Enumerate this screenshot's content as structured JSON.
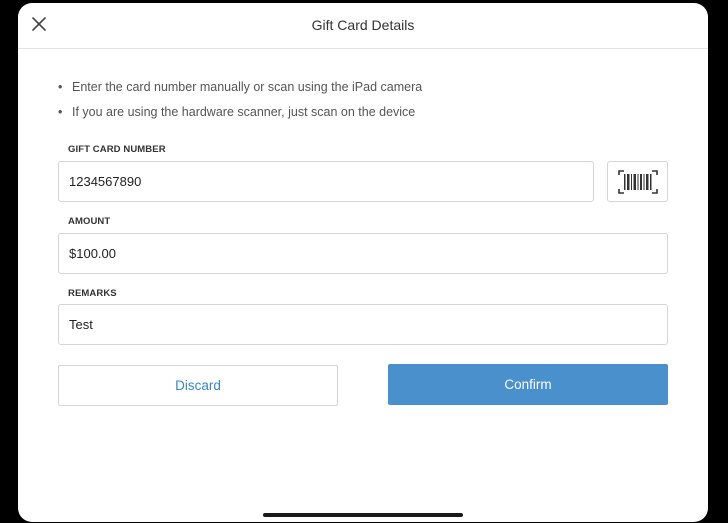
{
  "header": {
    "title": "Gift Card Details",
    "close_icon": "close-icon"
  },
  "instructions": [
    "Enter the card number manually or scan using the iPad camera",
    "If you are using the hardware scanner, just scan on the device"
  ],
  "bullet": "•",
  "fields": {
    "gift_card_number": {
      "label": "GIFT CARD NUMBER",
      "value": "1234567890"
    },
    "amount": {
      "label": "AMOUNT",
      "value": "$100.00"
    },
    "remarks": {
      "label": "REMARKS",
      "value": "Test"
    }
  },
  "scan_button_icon": "barcode-scan-icon",
  "buttons": {
    "discard": "Discard",
    "confirm": "Confirm"
  },
  "colors": {
    "accent": "#4a90cd",
    "link_text": "#3a86c4",
    "border": "#d6d6d6",
    "background": "#ffffff"
  }
}
